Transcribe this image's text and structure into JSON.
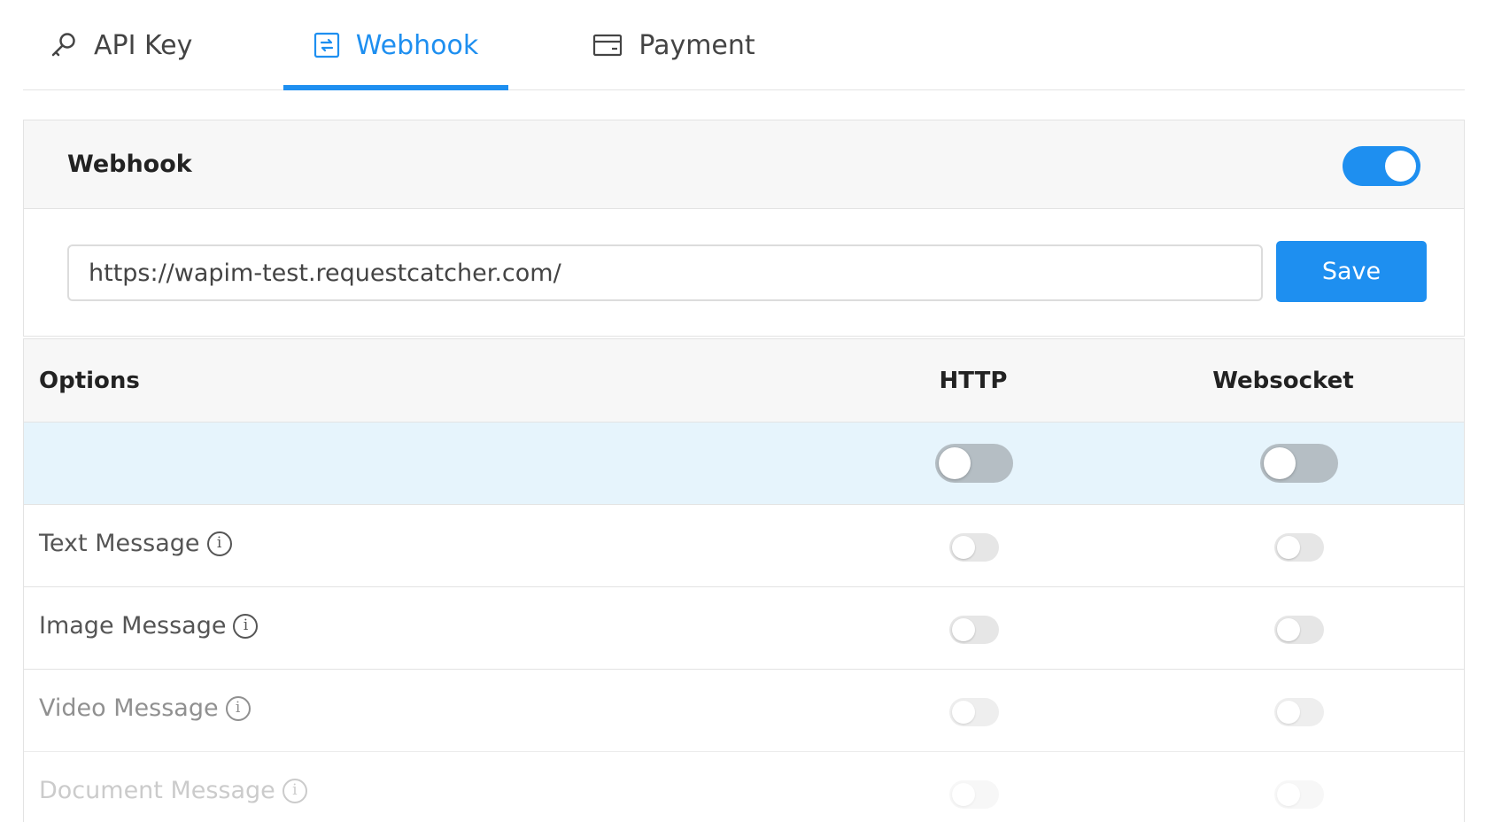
{
  "tabs": [
    {
      "label": "API Key",
      "icon": "key-icon",
      "active": false
    },
    {
      "label": "Webhook",
      "icon": "sync-icon",
      "active": true
    },
    {
      "label": "Payment",
      "icon": "credit-card-icon",
      "active": false
    }
  ],
  "webhook": {
    "title": "Webhook",
    "enabled": true,
    "url": "https://wapim-test.requestcatcher.com/",
    "save_label": "Save"
  },
  "options": {
    "headers": {
      "options": "Options",
      "http": "HTTP",
      "websocket": "Websocket"
    },
    "all": {
      "http": false,
      "websocket": false
    },
    "items": [
      {
        "label": "Text Message",
        "http": false,
        "websocket": false
      },
      {
        "label": "Image Message",
        "http": false,
        "websocket": false
      },
      {
        "label": "Video Message",
        "http": false,
        "websocket": false
      },
      {
        "label": "Document Message",
        "http": false,
        "websocket": false
      }
    ]
  },
  "colors": {
    "accent": "#1e8ff0",
    "highlight_row": "#e6f4fc"
  }
}
